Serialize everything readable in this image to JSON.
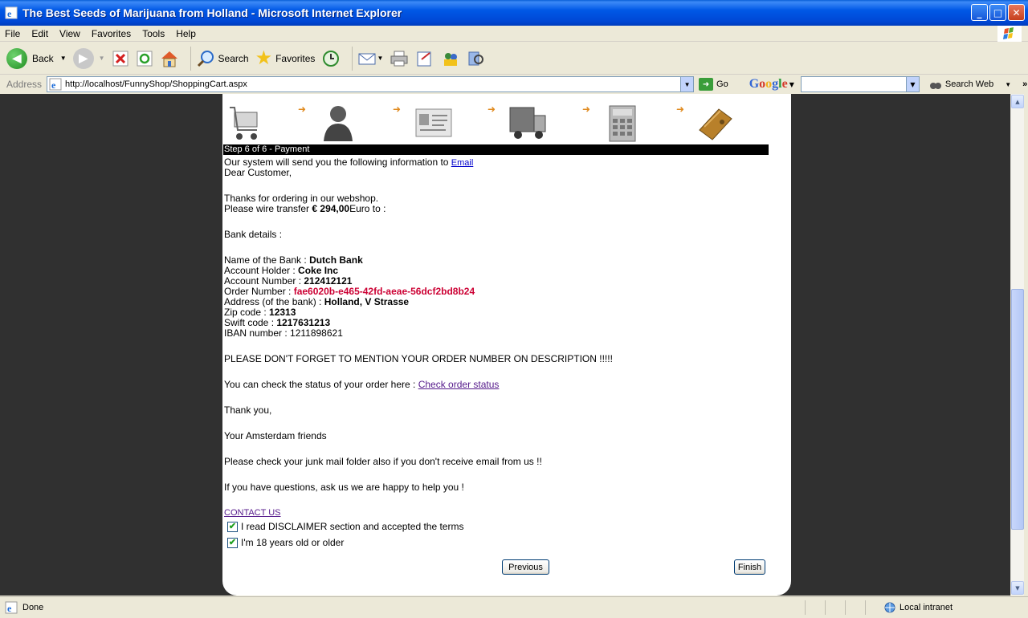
{
  "window": {
    "title": "The Best Seeds of Marijuana from Holland - Microsoft Internet Explorer",
    "minimize": "_",
    "maximize": "□",
    "close": "✕"
  },
  "menu": {
    "items": [
      "File",
      "Edit",
      "View",
      "Favorites",
      "Tools",
      "Help"
    ]
  },
  "toolbar": {
    "back_label": "Back",
    "search_label": "Search",
    "favorites_label": "Favorites"
  },
  "address": {
    "label": "Address",
    "url": "http://localhost/FunnyShop/ShoppingCart.aspx",
    "go_label": "Go",
    "google_label": "Google",
    "search_web_label": "Search Web",
    "search_value": ""
  },
  "checkout": {
    "step_label": "Step 6 of 6 - Payment",
    "send_info_text": "Our system will send you the following information to ",
    "email_link": "Email",
    "greeting": "Dear Customer,",
    "thanks": "Thanks for ordering in our webshop.",
    "wire_prefix": "Please wire transfer ",
    "amount": "€ 294,00",
    "wire_suffix": "Euro to :",
    "bank_details_heading": "Bank details :",
    "bank_name_label": "Name of the Bank : ",
    "bank_name": "Dutch Bank",
    "account_holder_label": "Account Holder : ",
    "account_holder": "Coke Inc",
    "account_number_label": "Account Number : ",
    "account_number": "212412121",
    "order_number_label": "Order Number : ",
    "order_number": "fae6020b-e465-42fd-aeae-56dcf2bd8b24",
    "address_label": "Address (of the bank) : ",
    "address_value": "Holland, V Strasse",
    "zip_label": "Zip code : ",
    "zip_value": "12313",
    "swift_label": "Swift code : ",
    "swift_value": "1217631213",
    "iban_label": "IBAN number : ",
    "iban_value": "1211898621",
    "warning": "PLEASE DON'T FORGET TO MENTION YOUR ORDER NUMBER ON DESCRIPTION !!!!!",
    "status_prefix": "You can check the status of your order here : ",
    "status_link": "Check order status",
    "thank_you": "Thank you,",
    "signature": "Your Amsterdam friends",
    "junk_notice": "Please check your junk mail folder also if you don't receive email from us !!",
    "questions": "If you have questions, ask us we are happy to help you !",
    "contact_link": "CONTACT US",
    "disclaimer_label": "I read DISCLAIMER section and accepted the terms",
    "disclaimer_checked": true,
    "age_label": "I'm 18 years old or older",
    "age_checked": true,
    "previous_button": "Previous",
    "finish_button": "Finish"
  },
  "status": {
    "text": "Done",
    "zone": "Local intranet"
  },
  "colors": {
    "title_blue": "#0054e3",
    "order_number_red": "#cc0033",
    "step_arrow_orange": "#e08a1e",
    "link_purple": "#551a8b"
  }
}
